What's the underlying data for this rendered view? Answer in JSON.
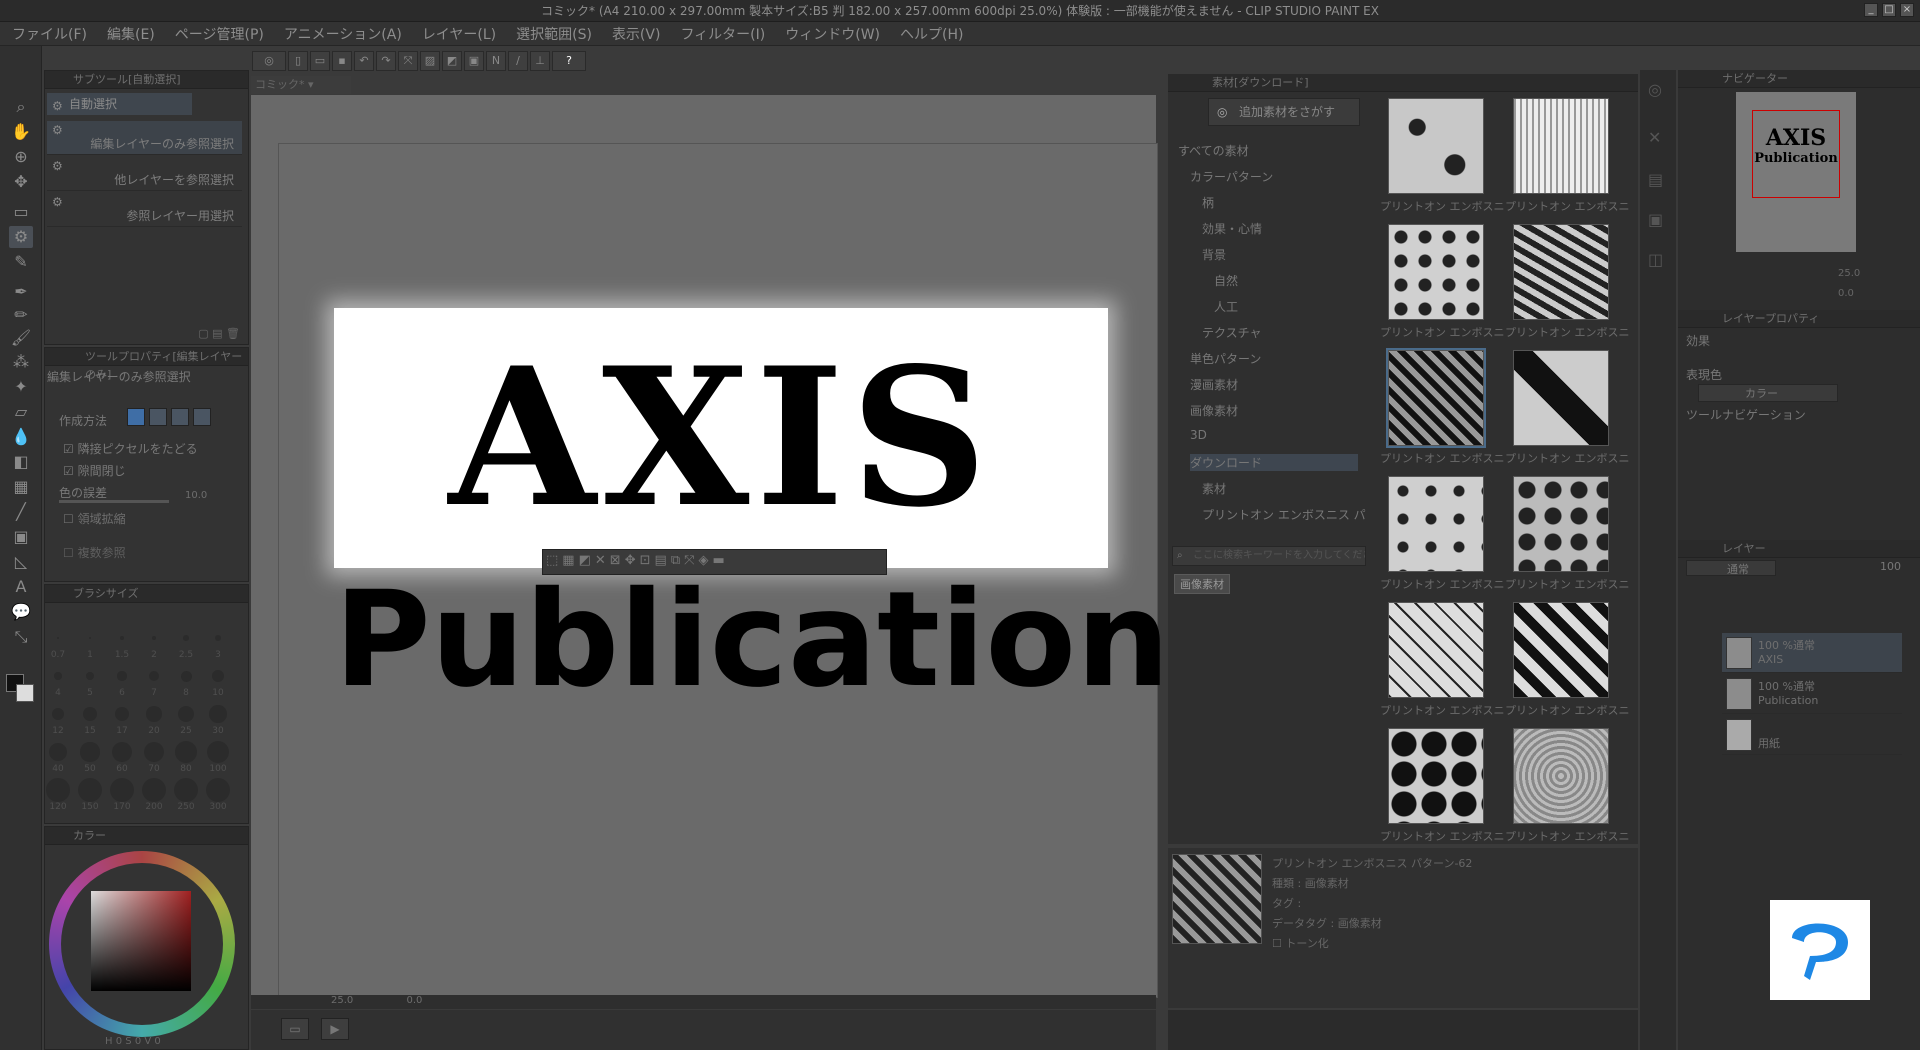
{
  "window": {
    "title": "コミック* (A4 210.00 x 297.00mm 製本サイズ:B5 判 182.00 x 257.00mm 600dpi 25.0%) 体験版 : 一部機能が使えません - CLIP STUDIO PAINT EX",
    "controls": [
      "_",
      "□",
      "×"
    ]
  },
  "menu": [
    "ファイル(F)",
    "編集(E)",
    "ページ管理(P)",
    "アニメーション(A)",
    "レイヤー(L)",
    "選択範囲(S)",
    "表示(V)",
    "フィルター(I)",
    "ウィンドウ(W)",
    "ヘルプ(H)"
  ],
  "subtool": {
    "header": "サブツール[自動選択]",
    "tab": "自動選択",
    "items": [
      "編集レイヤーのみ参照選択",
      "他レイヤーを参照選択",
      "参照レイヤー用選択"
    ]
  },
  "toolprop": {
    "header": "ツールプロパティ[編集レイヤーのみ]",
    "name": "編集レイヤーのみ参照選択",
    "method_label": "作成方法",
    "adjacent_label": "隣接ピクセルをたどる",
    "gap_label": "隙間閉じ",
    "tolerance_label": "色の誤差",
    "tolerance_value": "10.0",
    "expand_label": "領域拡縮",
    "multi_ref_label": "複数参照"
  },
  "brushsize": {
    "header": "ブラシサイズ",
    "sizes": [
      "0.7",
      "1",
      "1.5",
      "2",
      "2.5",
      "3",
      "4",
      "5",
      "6",
      "7",
      "8",
      "10",
      "12",
      "15",
      "17",
      "20",
      "25",
      "30",
      "40",
      "50",
      "60",
      "70",
      "80",
      "100",
      "120",
      "150",
      "170",
      "200",
      "250",
      "300"
    ]
  },
  "color": {
    "header": "カラー",
    "hsv": [
      "H",
      "S",
      "V"
    ],
    "hsv_values": [
      "0",
      "0",
      "0"
    ]
  },
  "document": {
    "tab": "コミック*",
    "zoom": "25.0",
    "rotation": "0.0"
  },
  "canvas_content": {
    "line1": "AXIS",
    "line2": "Publication"
  },
  "material": {
    "header": "素材[ダウンロード]",
    "search_button": "追加素材をさがす",
    "tree": [
      {
        "label": "すべての素材",
        "indent": 0
      },
      {
        "label": "カラーパターン",
        "indent": 1
      },
      {
        "label": "柄",
        "indent": 2
      },
      {
        "label": "効果・心情",
        "indent": 2
      },
      {
        "label": "背景",
        "indent": 2
      },
      {
        "label": "自然",
        "indent": 3
      },
      {
        "label": "人工",
        "indent": 3
      },
      {
        "label": "テクスチャ",
        "indent": 2
      },
      {
        "label": "単色パターン",
        "indent": 1
      },
      {
        "label": "漫画素材",
        "indent": 1
      },
      {
        "label": "画像素材",
        "indent": 1
      },
      {
        "label": "3D",
        "indent": 1
      },
      {
        "label": "ダウンロード",
        "indent": 1
      },
      {
        "label": "素材",
        "indent": 2
      },
      {
        "label": "プリントオン エンボスニス パ",
        "indent": 2
      }
    ],
    "search_placeholder": "ここに検索キーワードを入力してください",
    "tag": "画像素材",
    "tile_caption": "プリントオン エンボスニス パター",
    "detail": {
      "name": "プリントオン エンボスニス パターン-62",
      "type": "種類 : 画像素材",
      "tag": "タグ :",
      "datatag": "データタグ : 画像素材",
      "tone": "トーン化"
    }
  },
  "navigator": {
    "header": "ナビゲーター",
    "zoom": "25.0",
    "rotate": "0.0"
  },
  "layerprop": {
    "header": "レイヤープロパティ",
    "effect": "効果",
    "expression_color": "表現色",
    "color_value": "カラー",
    "toolnav": "ツールナビゲーション"
  },
  "layers": {
    "header": "レイヤー",
    "blend": "通常",
    "opacity": "100",
    "items": [
      {
        "mode": "100 %通常",
        "name": "AXIS"
      },
      {
        "mode": "100 %通常",
        "name": "Publication"
      },
      {
        "mode": "",
        "name": "用紙"
      }
    ]
  },
  "colors": {
    "bg": "#3a3a3a",
    "panel": "#333333",
    "accent": "#4a6b8a",
    "brand": "#1e88e5"
  }
}
